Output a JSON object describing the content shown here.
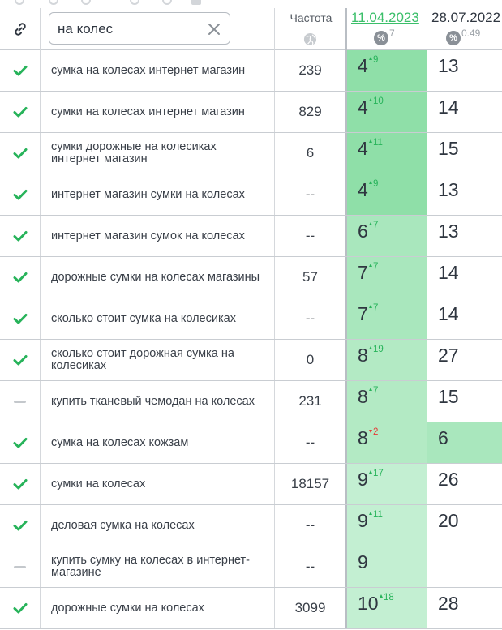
{
  "search": {
    "value": "на колес"
  },
  "columns": {
    "frequency": "Частота",
    "date1": {
      "label": "11.04.2023",
      "percent": "7",
      "color": "#3bbf6a"
    },
    "date2": {
      "label": "28.07.2022",
      "percent": "0.49"
    }
  },
  "icons": {
    "link": "link-icon",
    "clear": "close-icon",
    "globe": "globe-icon",
    "percent": "percent-icon",
    "checked": "check-icon",
    "unchecked": "dash-icon"
  },
  "colors": {
    "check": "#27b35a",
    "up": "#27b35a",
    "down": "#e53935",
    "top_bg": "#8fdfa8",
    "mid_bg": "#a9e7bd",
    "low_bg": "#c3efd2"
  },
  "rows": [
    {
      "status": "checked",
      "keyword": "сумка на колесах интернет магазин",
      "freq": "239",
      "pos1": "4",
      "chg1": "9",
      "dir1": "up",
      "pos2": "13",
      "bg1": "#8fdfa8"
    },
    {
      "status": "checked",
      "keyword": "сумки на колесах интернет магазин",
      "freq": "829",
      "pos1": "4",
      "chg1": "10",
      "dir1": "up",
      "pos2": "14",
      "bg1": "#8fdfa8"
    },
    {
      "status": "checked",
      "keyword": "сумки дорожные на колесиках интернет магазин",
      "freq": "6",
      "pos1": "4",
      "chg1": "11",
      "dir1": "up",
      "pos2": "15",
      "bg1": "#8fdfa8"
    },
    {
      "status": "checked",
      "keyword": "интернет магазин сумки на колесах",
      "freq": "--",
      "pos1": "4",
      "chg1": "9",
      "dir1": "up",
      "pos2": "13",
      "bg1": "#8fdfa8"
    },
    {
      "status": "checked",
      "keyword": "интернет магазин сумок на колесах",
      "freq": "--",
      "pos1": "6",
      "chg1": "7",
      "dir1": "up",
      "pos2": "13",
      "bg1": "#a9e7bd"
    },
    {
      "status": "checked",
      "keyword": "дорожные сумки на колесах магазины",
      "freq": "57",
      "pos1": "7",
      "chg1": "7",
      "dir1": "up",
      "pos2": "14",
      "bg1": "#a9e7bd"
    },
    {
      "status": "checked",
      "keyword": "сколько стоит сумка на колесиках",
      "freq": "--",
      "pos1": "7",
      "chg1": "7",
      "dir1": "up",
      "pos2": "14",
      "bg1": "#a9e7bd"
    },
    {
      "status": "checked",
      "keyword": "сколько стоит дорожная сумка на колесиках",
      "freq": "0",
      "pos1": "8",
      "chg1": "19",
      "dir1": "up",
      "pos2": "27",
      "bg1": "#b3eac4"
    },
    {
      "status": "unchecked",
      "keyword": "купить тканевый чемодан на колесах",
      "freq": "231",
      "pos1": "8",
      "chg1": "7",
      "dir1": "up",
      "pos2": "15",
      "bg1": "#b3eac4"
    },
    {
      "status": "checked",
      "keyword": "сумка на колесах кожзам",
      "freq": "--",
      "pos1": "8",
      "chg1": "2",
      "dir1": "down",
      "pos2": "6",
      "bg1": "#b3eac4",
      "bg2": "#a9e7bd"
    },
    {
      "status": "checked",
      "keyword": "сумки на колесах",
      "freq": "18157",
      "pos1": "9",
      "chg1": "17",
      "dir1": "up",
      "pos2": "26",
      "bg1": "#c3efd2"
    },
    {
      "status": "checked",
      "keyword": "деловая сумка на колесах",
      "freq": "--",
      "pos1": "9",
      "chg1": "11",
      "dir1": "up",
      "pos2": "20",
      "bg1": "#c3efd2"
    },
    {
      "status": "unchecked",
      "keyword": "купить сумку на колесах в интернет-магазине",
      "freq": "--",
      "pos1": "9",
      "chg1": "",
      "dir1": "",
      "pos2": "",
      "bg1": "#c3efd2"
    },
    {
      "status": "checked",
      "keyword": "дорожные сумки на колесах",
      "freq": "3099",
      "pos1": "10",
      "chg1": "18",
      "dir1": "up",
      "pos2": "28",
      "bg1": "#c3efd2"
    }
  ]
}
